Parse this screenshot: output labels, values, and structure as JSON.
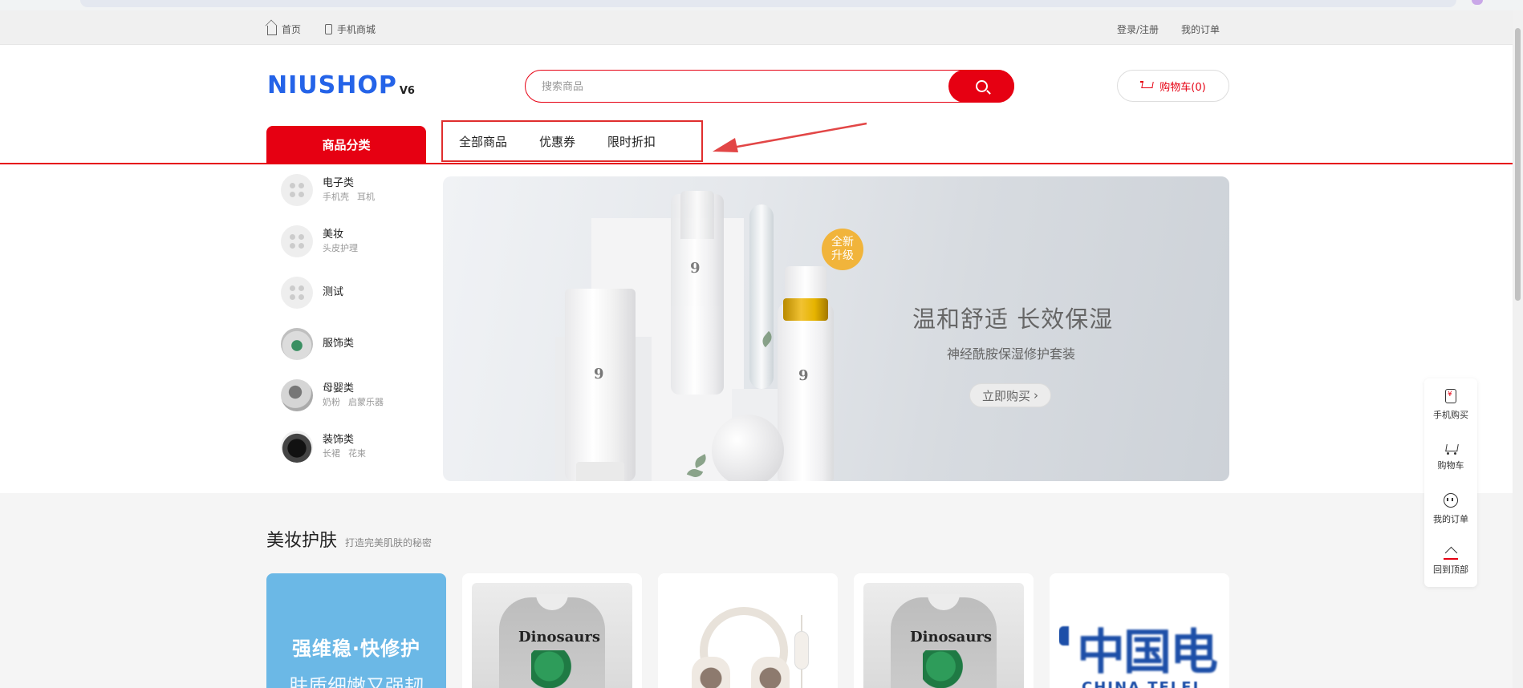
{
  "topbar": {
    "home_label": "首页",
    "mobile_label": "手机商城",
    "login_label": "登录/注册",
    "orders_label": "我的订单"
  },
  "header": {
    "logo_text": "NIUSHOP",
    "logo_version": "V6",
    "search_placeholder": "搜索商品",
    "cart_label": "购物车(0)"
  },
  "nav": {
    "category_label": "商品分类",
    "items": [
      {
        "label": "全部商品"
      },
      {
        "label": "优惠券"
      },
      {
        "label": "限时折扣"
      }
    ]
  },
  "categories": [
    {
      "name": "电子类",
      "subs": [
        "手机壳",
        "耳机"
      ]
    },
    {
      "name": "美妆",
      "subs": [
        "头皮护理"
      ]
    },
    {
      "name": "测试",
      "subs": []
    },
    {
      "name": "服饰类",
      "subs": []
    },
    {
      "name": "母婴类",
      "subs": [
        "奶粉",
        "启蒙乐器"
      ]
    },
    {
      "name": "装饰类",
      "subs": [
        "长裙",
        "花束"
      ]
    }
  ],
  "banner": {
    "badge_line1": "全新",
    "badge_line2": "升级",
    "headline": "温和舒适 长效保湿",
    "subline": "神经酰胺保湿修护套装",
    "buy_label": "立即购买",
    "buy_arrow": "›",
    "product_mark": "9"
  },
  "section": {
    "title": "美妆护肤",
    "description": "打造完美肌肤的秘密",
    "promo_line1": "强维稳·快修护",
    "promo_line2": "肤质细嫩又强韧",
    "products": [
      {
        "image": "dinosaurs-shirt",
        "print_text": "Dinosaurs"
      },
      {
        "image": "headphones"
      },
      {
        "image": "dinosaurs-shirt",
        "print_text": "Dinosaurs"
      },
      {
        "image": "china-telecom-logo",
        "logo_text_cn": "中国电",
        "logo_text_en": "CHINA TELEI"
      }
    ]
  },
  "side_toolbar": {
    "items": [
      {
        "label": "手机购买",
        "icon": "phone-yuan-icon"
      },
      {
        "label": "购物车",
        "icon": "cart-icon"
      },
      {
        "label": "我的订单",
        "icon": "order-icon"
      },
      {
        "label": "回到顶部",
        "icon": "back-to-top-icon"
      }
    ]
  },
  "colors": {
    "brand_red": "#e60012",
    "logo_blue": "#2463e8",
    "annotation_red": "#e02e2e"
  }
}
